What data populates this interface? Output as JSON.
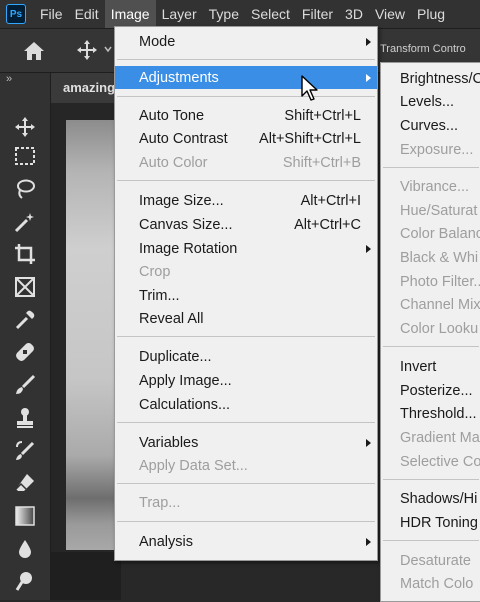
{
  "menubar": {
    "logo": "Ps",
    "items": [
      "File",
      "Edit",
      "Image",
      "Layer",
      "Type",
      "Select",
      "Filter",
      "3D",
      "View",
      "Plug"
    ],
    "active_index": 2
  },
  "options_bar": {
    "transform_controls": "Transform Contro"
  },
  "toolbar": {
    "collapse_glyph": "»",
    "tools": [
      "move-tool",
      "marquee-tool",
      "lasso-tool",
      "magic-wand-tool",
      "crop-tool",
      "frame-tool",
      "eyedropper-tool",
      "healing-brush-tool",
      "brush-tool",
      "clone-stamp-tool",
      "history-brush-tool",
      "eraser-tool",
      "gradient-tool",
      "blur-tool",
      "dodge-tool"
    ]
  },
  "document": {
    "tab_title": "amazing"
  },
  "image_menu": {
    "mode": "Mode",
    "adjustments": "Adjustments",
    "auto_tone": {
      "label": "Auto Tone",
      "shortcut": "Shift+Ctrl+L"
    },
    "auto_contrast": {
      "label": "Auto Contrast",
      "shortcut": "Alt+Shift+Ctrl+L"
    },
    "auto_color": {
      "label": "Auto Color",
      "shortcut": "Shift+Ctrl+B"
    },
    "image_size": {
      "label": "Image Size...",
      "shortcut": "Alt+Ctrl+I"
    },
    "canvas_size": {
      "label": "Canvas Size...",
      "shortcut": "Alt+Ctrl+C"
    },
    "image_rotation": "Image Rotation",
    "crop": "Crop",
    "trim": "Trim...",
    "reveal_all": "Reveal All",
    "duplicate": "Duplicate...",
    "apply_image": "Apply Image...",
    "calculations": "Calculations...",
    "variables": "Variables",
    "apply_data_set": "Apply Data Set...",
    "trap": "Trap...",
    "analysis": "Analysis"
  },
  "adjustments_submenu": {
    "brightness_contrast": "Brightness/C",
    "levels": "Levels...",
    "curves": "Curves...",
    "exposure": "Exposure...",
    "vibrance": "Vibrance...",
    "hue_saturation": "Hue/Saturat",
    "color_balance": "Color Balanc",
    "black_white": "Black & Whi",
    "photo_filter": "Photo Filter...",
    "channel_mixer": "Channel Mix",
    "color_lookup": "Color Looku",
    "invert": "Invert",
    "posterize": "Posterize...",
    "threshold": "Threshold...",
    "gradient_map": "Gradient Ma",
    "selective_color": "Selective Co",
    "shadows_highlights": "Shadows/Hi",
    "hdr_toning": "HDR Toning",
    "desaturate": "Desaturate",
    "match_color": "Match Colo"
  },
  "colors": {
    "menu_highlight": "#3a8ee6",
    "menu_background": "#f0f0f0",
    "app_background": "#282828",
    "disabled_text": "#9e9e9e"
  }
}
